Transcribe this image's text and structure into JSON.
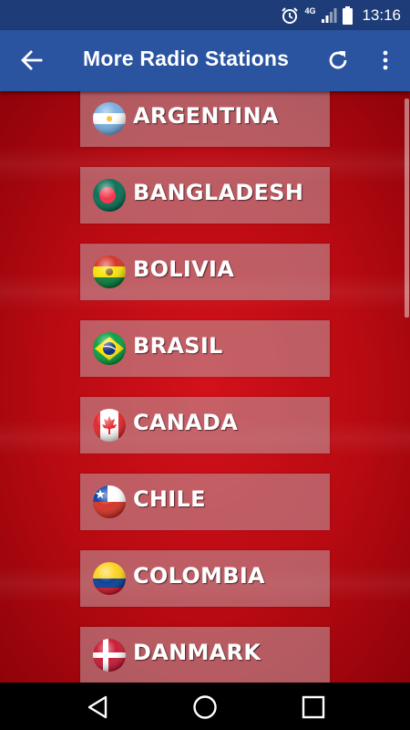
{
  "status_bar": {
    "time": "13:16",
    "network": "4G"
  },
  "app_bar": {
    "title": "More Radio Stations"
  },
  "countries": [
    {
      "name": "ARGENTINA",
      "flag": "argentina-flag-icon"
    },
    {
      "name": "BANGLADESH",
      "flag": "bangladesh-flag-icon"
    },
    {
      "name": "BOLIVIA",
      "flag": "bolivia-flag-icon"
    },
    {
      "name": "BRASIL",
      "flag": "brasil-flag-icon"
    },
    {
      "name": "CANADA",
      "flag": "canada-flag-icon"
    },
    {
      "name": "CHILE",
      "flag": "chile-flag-icon"
    },
    {
      "name": "COLOMBIA",
      "flag": "colombia-flag-icon"
    },
    {
      "name": "DANMARK",
      "flag": "danmark-flag-icon"
    }
  ],
  "colors": {
    "app_bar": "#2a53a0",
    "status_bar": "#1e3d78",
    "background": "#c20e16",
    "item_overlay": "#bea0a5"
  }
}
